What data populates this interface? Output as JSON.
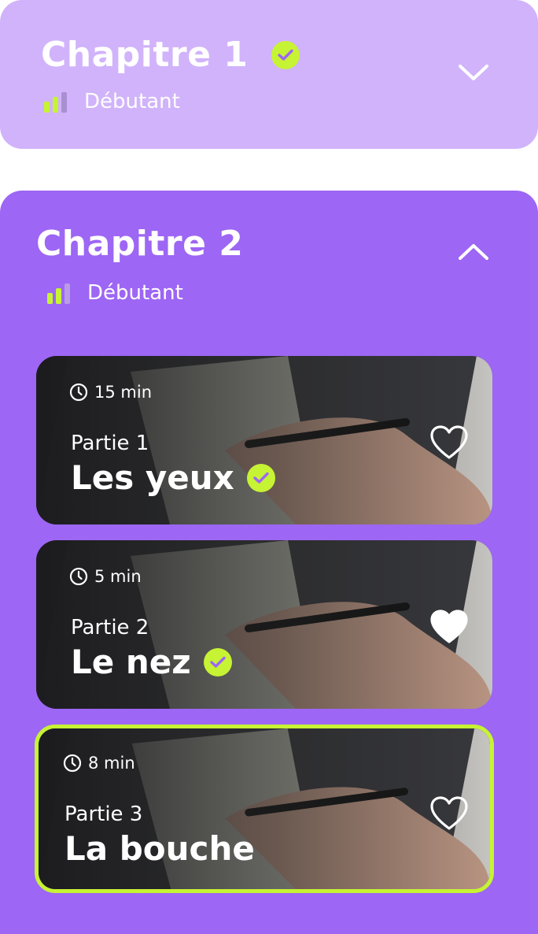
{
  "chapters": [
    {
      "title": "Chapitre 1",
      "completed": true,
      "level": "Débutant",
      "expanded": false
    },
    {
      "title": "Chapitre 2",
      "completed": false,
      "level": "Débutant",
      "expanded": true
    }
  ],
  "lessons": [
    {
      "duration": "15 min",
      "part": "Partie 1",
      "title": "Les yeux",
      "completed": true,
      "favorite": false,
      "active": false
    },
    {
      "duration": "5 min",
      "part": "Partie 2",
      "title": "Le nez",
      "completed": true,
      "favorite": true,
      "active": false
    },
    {
      "duration": "8 min",
      "part": "Partie 3",
      "title": "La bouche",
      "completed": false,
      "favorite": false,
      "active": true
    }
  ],
  "colors": {
    "chapter_collapsed_bg": "#d1b3fb",
    "chapter_expanded_bg": "#9d66f4",
    "accent": "#c6f333",
    "text": "#ffffff"
  },
  "icons": [
    "check-circle-icon",
    "chevron-down-icon",
    "chevron-up-icon",
    "level-bars-icon",
    "clock-icon",
    "heart-outline-icon",
    "heart-filled-icon"
  ]
}
